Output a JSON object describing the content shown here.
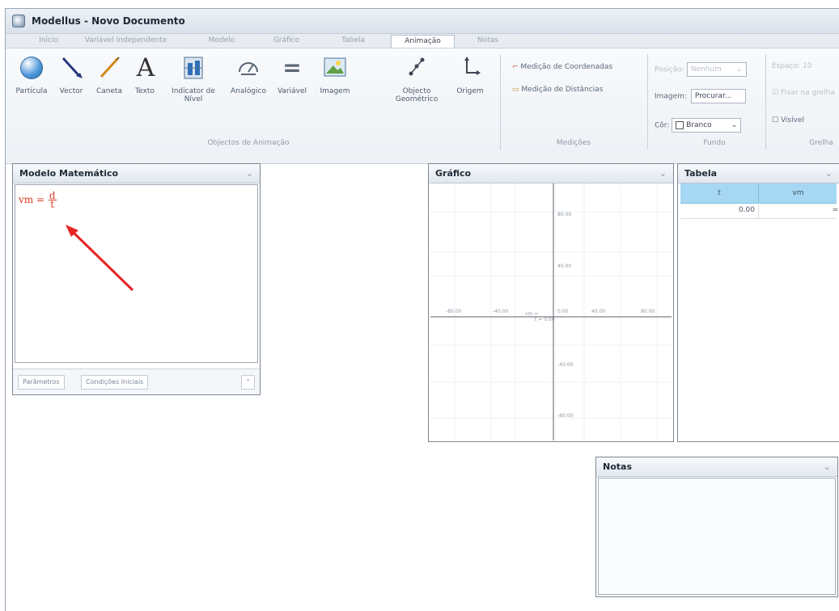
{
  "window": {
    "title": "Modellus - Novo Documento"
  },
  "menu": [
    "Início",
    "Variável Independente",
    "Modelo",
    "Gráfico",
    "Tabela",
    "Animação",
    "Notas"
  ],
  "ribbon": {
    "buttons": [
      "Partícula",
      "Vector",
      "Caneta",
      "Texto",
      "Indicator de Nível",
      "Analógico",
      "Variável",
      "Imagem",
      "Objecto Geométrico",
      "Origem"
    ],
    "group_animation": "Objectos de Animação",
    "measure": {
      "coords": "Medição de Coordenadas",
      "dist": "Medição de Distâncias",
      "label": "Medições"
    },
    "background": {
      "position_label": "Posição:",
      "position_value": "Nenhum",
      "image_label": "Imagem:",
      "image_button": "Procurar...",
      "color_label": "Côr:",
      "color_value": "Branco",
      "label": "Fundo"
    },
    "grid": {
      "spacing_label": "Espaço:",
      "spacing_value": "10",
      "fix_label": "Fixar na grelha",
      "visible_label": "Visível",
      "label": "Grelha"
    }
  },
  "model_panel": {
    "title": "Modelo Matemático",
    "expression_left": "vm =",
    "expression_num": "d",
    "expression_den": "t",
    "footer": [
      "Parâmetros",
      "Condições Iniciais"
    ]
  },
  "graph_panel": {
    "title": "Gráfico",
    "x_ticks": [
      "-80.00",
      "-40.00",
      "0.00",
      "40.00",
      "80.00"
    ],
    "y_ticks": [
      "80.00",
      "40.00",
      "-40.00",
      "-80.00"
    ],
    "x_var": "vm =",
    "t_label": "t = 0.00"
  },
  "table_panel": {
    "title": "Tabela",
    "headers": [
      "t",
      "vm"
    ],
    "rows": [
      [
        "0.00",
        "="
      ]
    ]
  },
  "notes_panel": {
    "title": "Notas"
  },
  "colors": {
    "accent": "#3d79c6",
    "annotation": "#e82324"
  }
}
